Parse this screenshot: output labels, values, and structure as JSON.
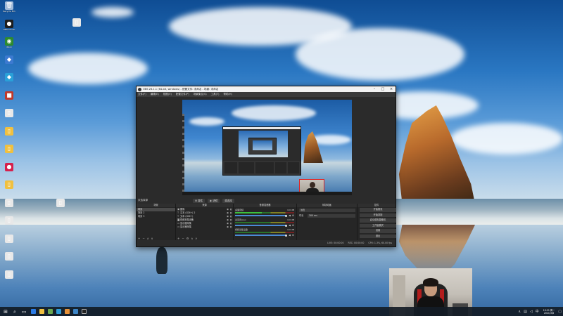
{
  "desktop": {
    "icons": [
      {
        "label": "Recycle Bin",
        "icon": "recycle-bin-icon",
        "glyph": "🗑",
        "color": "#9fb9d9"
      },
      {
        "label": "OBS Studio",
        "icon": "obs-icon",
        "glyph": "●",
        "color": "#1d1d1d"
      },
      {
        "label": "Xbox",
        "icon": "xbox-icon",
        "glyph": "◉",
        "color": "#2e8b2e"
      },
      {
        "label": "",
        "icon": "app-icon",
        "glyph": "◆",
        "color": "#3c7ad0"
      },
      {
        "label": "",
        "icon": "app-icon",
        "glyph": "◆",
        "color": "#2aa0d8"
      },
      {
        "label": "",
        "icon": "app-icon",
        "glyph": "■",
        "color": "#c0392b"
      },
      {
        "label": "",
        "icon": "file-icon",
        "glyph": "▯",
        "color": "#e8e8e8"
      },
      {
        "label": "",
        "icon": "file-icon",
        "glyph": "▯",
        "color": "#f0c040"
      },
      {
        "label": "",
        "icon": "file-icon",
        "glyph": "▯",
        "color": "#f0c040"
      },
      {
        "label": "",
        "icon": "app-icon",
        "glyph": "●",
        "color": "#d6204c"
      },
      {
        "label": "",
        "icon": "file-icon",
        "glyph": "▯",
        "color": "#f0c040"
      },
      {
        "label": "",
        "icon": "file-icon",
        "glyph": "▯",
        "color": "#e8e8e8"
      },
      {
        "label": "",
        "icon": "file-icon",
        "glyph": "▯",
        "color": "#e8e8e8"
      },
      {
        "label": "",
        "icon": "file-icon",
        "glyph": "▯",
        "color": "#e8e8e8"
      },
      {
        "label": "",
        "icon": "file-icon",
        "glyph": "▯",
        "color": "#e8e8e8"
      },
      {
        "label": "",
        "icon": "file-icon",
        "glyph": "▯",
        "color": "#e8e8e8"
      }
    ],
    "extra_icons": [
      {
        "label": "",
        "icon": "file-icon",
        "glyph": "▯",
        "color": "#e8e8e8"
      },
      {
        "label": "",
        "icon": "file-icon",
        "glyph": "▯",
        "color": "#e8e8e8"
      }
    ]
  },
  "obs": {
    "title": "OBS 26.1.1 (64-bit, windows) - 配置文件: 未命名 - 场景: 未命名",
    "menu": [
      "文件(F)",
      "编辑(E)",
      "视图(V)",
      "配置文件(P)",
      "场景集合(S)",
      "工具(T)",
      "帮助(H)"
    ],
    "toolbar": {
      "no_source": "未选择源",
      "properties": "属性",
      "filters": "滤镜",
      "to_studio": "源选择"
    },
    "docks": {
      "scenes": {
        "header": "场景",
        "items": [
          "场景",
          "场景 2",
          "场景 3"
        ]
      },
      "sources": {
        "header": "来源",
        "items": [
          {
            "name": "图像",
            "icon": "image-icon",
            "glyph": "▣"
          },
          {
            "name": "文本 (GDI+) 2",
            "icon": "text-icon",
            "glyph": "T"
          },
          {
            "name": "文本 (GDI+)",
            "icon": "text-icon",
            "glyph": "T"
          },
          {
            "name": "视频采集设备",
            "icon": "camera-icon",
            "glyph": "◙"
          },
          {
            "name": "显示器采集",
            "icon": "monitor-icon",
            "glyph": "▭"
          },
          {
            "name": "显示器采集",
            "icon": "monitor-icon",
            "glyph": "▭"
          }
        ]
      },
      "mixer": {
        "header": "音频混音器",
        "channels": [
          {
            "name": "桌面音频",
            "db": "0.0 dB"
          },
          {
            "name": "麦克风/Aux",
            "db": "0.0 dB"
          },
          {
            "name": "视频采集设备",
            "db": "0.0 dB"
          }
        ]
      },
      "transitions": {
        "header": "转场动画",
        "selected": "淡出",
        "duration_label": "时长",
        "duration": "300 ms"
      },
      "controls": {
        "header": "控件",
        "buttons": [
          "开始推流",
          "开始录制",
          "启动虚拟摄像机",
          "工作室模式",
          "设置",
          "退出"
        ]
      }
    },
    "status": {
      "live": "LIVE: 00:00:00",
      "rec": "REC: 00:00:00",
      "cpu": "CPU: 1.3%, 60.00 fps"
    }
  },
  "taskbar": {
    "clock_time": "19:21 周一",
    "clock_date": "2021/3/8"
  },
  "colors": {
    "accent": "#4b8ad6",
    "recording_border": "#e02020"
  }
}
